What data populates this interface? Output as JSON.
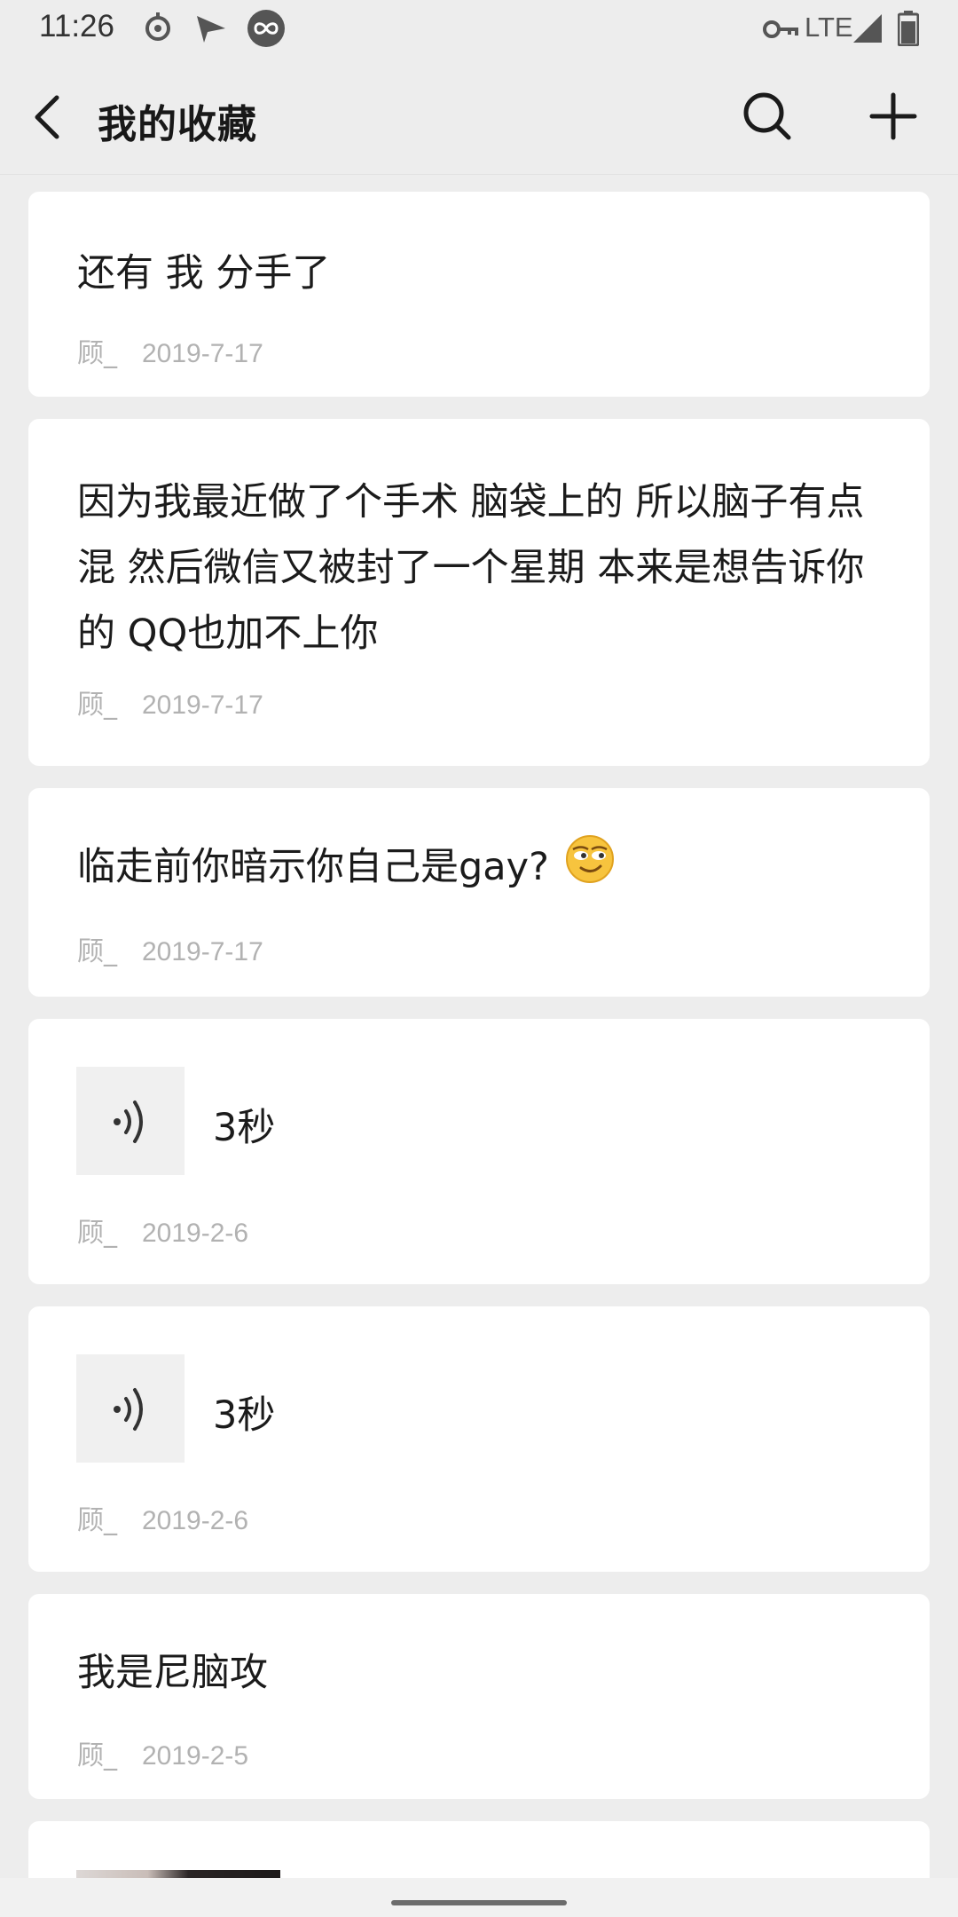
{
  "status_bar": {
    "time": "11:26",
    "network": "LTE",
    "icons": [
      "sync-icon",
      "send-icon",
      "infinity-icon",
      "vpn-key-icon",
      "signal-icon",
      "battery-icon"
    ]
  },
  "header": {
    "title": "我的收藏",
    "back_icon": "chevron-left-icon",
    "search_icon": "search-icon",
    "add_icon": "plus-icon"
  },
  "favorites": [
    {
      "type": "text",
      "text": "还有 我 分手了",
      "author": "顾_",
      "date": "2019-7-17"
    },
    {
      "type": "text",
      "text": "因为我最近做了个手术 脑袋上的 所以脑子有点混 然后微信又被封了一个星期 本来是想告诉你的 QQ也加不上你",
      "author": "顾_",
      "date": "2019-7-17"
    },
    {
      "type": "text",
      "text": "临走前你暗示你自己是gay?",
      "emoji": "smirk-emoji-icon",
      "author": "顾_",
      "date": "2019-7-17"
    },
    {
      "type": "voice",
      "duration": "3秒",
      "author": "顾_",
      "date": "2019-2-6"
    },
    {
      "type": "voice",
      "duration": "3秒",
      "author": "顾_",
      "date": "2019-2-6"
    },
    {
      "type": "text",
      "text": "我是尼脑攻",
      "author": "顾_",
      "date": "2019-2-5"
    },
    {
      "type": "image"
    }
  ],
  "colors": {
    "background": "#ededed",
    "card": "#ffffff",
    "meta_text": "#b2b2b2",
    "primary_text": "#1b1b1b"
  }
}
